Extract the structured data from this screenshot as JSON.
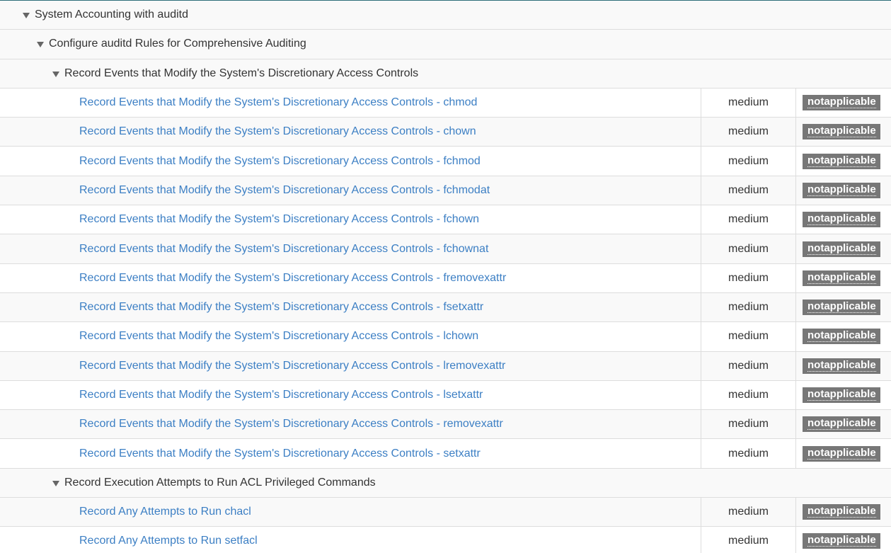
{
  "groups": {
    "level1": {
      "title": "System Accounting with auditd"
    },
    "level2": {
      "title": "Configure auditd Rules for Comprehensive Auditing"
    },
    "dac": {
      "title": "Record Events that Modify the System's Discretionary Access Controls"
    },
    "acl": {
      "title": "Record Execution Attempts to Run ACL Privileged Commands"
    }
  },
  "dac_rules": [
    {
      "title": "Record Events that Modify the System's Discretionary Access Controls - chmod",
      "severity": "medium",
      "result": "notapplicable"
    },
    {
      "title": "Record Events that Modify the System's Discretionary Access Controls - chown",
      "severity": "medium",
      "result": "notapplicable"
    },
    {
      "title": "Record Events that Modify the System's Discretionary Access Controls - fchmod",
      "severity": "medium",
      "result": "notapplicable"
    },
    {
      "title": "Record Events that Modify the System's Discretionary Access Controls - fchmodat",
      "severity": "medium",
      "result": "notapplicable"
    },
    {
      "title": "Record Events that Modify the System's Discretionary Access Controls - fchown",
      "severity": "medium",
      "result": "notapplicable"
    },
    {
      "title": "Record Events that Modify the System's Discretionary Access Controls - fchownat",
      "severity": "medium",
      "result": "notapplicable"
    },
    {
      "title": "Record Events that Modify the System's Discretionary Access Controls - fremovexattr",
      "severity": "medium",
      "result": "notapplicable"
    },
    {
      "title": "Record Events that Modify the System's Discretionary Access Controls - fsetxattr",
      "severity": "medium",
      "result": "notapplicable"
    },
    {
      "title": "Record Events that Modify the System's Discretionary Access Controls - lchown",
      "severity": "medium",
      "result": "notapplicable"
    },
    {
      "title": "Record Events that Modify the System's Discretionary Access Controls - lremovexattr",
      "severity": "medium",
      "result": "notapplicable"
    },
    {
      "title": "Record Events that Modify the System's Discretionary Access Controls - lsetxattr",
      "severity": "medium",
      "result": "notapplicable"
    },
    {
      "title": "Record Events that Modify the System's Discretionary Access Controls - removexattr",
      "severity": "medium",
      "result": "notapplicable"
    },
    {
      "title": "Record Events that Modify the System's Discretionary Access Controls - setxattr",
      "severity": "medium",
      "result": "notapplicable"
    }
  ],
  "acl_rules": [
    {
      "title": "Record Any Attempts to Run chacl",
      "severity": "medium",
      "result": "notapplicable"
    },
    {
      "title": "Record Any Attempts to Run setfacl",
      "severity": "medium",
      "result": "notapplicable"
    }
  ],
  "colors": {
    "link": "#3c7fc4",
    "badge_bg": "#777777",
    "group_bg": "#f9f9f9",
    "border": "#dddddd"
  },
  "icons": {
    "group_toggle": "triangle-down"
  }
}
